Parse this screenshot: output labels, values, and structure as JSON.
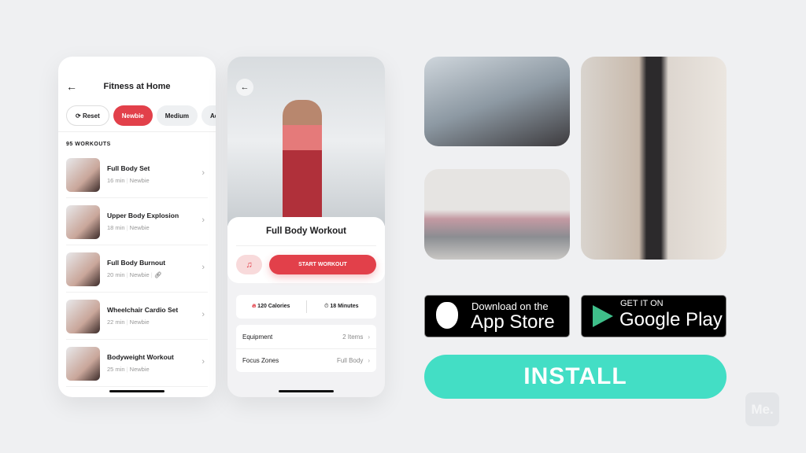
{
  "list_screen": {
    "title": "Fitness at Home",
    "filters": [
      "Reset",
      "Newbie",
      "Medium",
      "Advance"
    ],
    "count": "95 WORKOUTS",
    "workouts": [
      {
        "name": "Full Body Set",
        "duration": "16 min",
        "level": "Newbie"
      },
      {
        "name": "Upper Body Explosion",
        "duration": "18 min",
        "level": "Newbie"
      },
      {
        "name": "Full Body Burnout",
        "duration": "20 min",
        "level": "Newbie"
      },
      {
        "name": "Wheelchair Cardio Set",
        "duration": "22 min",
        "level": "Newbie"
      },
      {
        "name": "Bodyweight Workout",
        "duration": "25 min",
        "level": "Newbie"
      }
    ]
  },
  "detail_screen": {
    "title": "Full Body Workout",
    "start_label": "START WORKOUT",
    "calories": "120 Calories",
    "minutes": "18 Minutes",
    "rows": [
      {
        "label": "Equipment",
        "value": "2 Items"
      },
      {
        "label": "Focus Zones",
        "value": "Full Body"
      }
    ]
  },
  "stores": {
    "apple_top": "Download on the",
    "apple_main": "App Store",
    "google_top": "GET IT ON",
    "google_main": "Google Play"
  },
  "install_label": "INSTALL",
  "watermark": "Me.",
  "colors": {
    "accent": "#e2404a",
    "install": "#43dec5",
    "background": "#eff0f2"
  }
}
